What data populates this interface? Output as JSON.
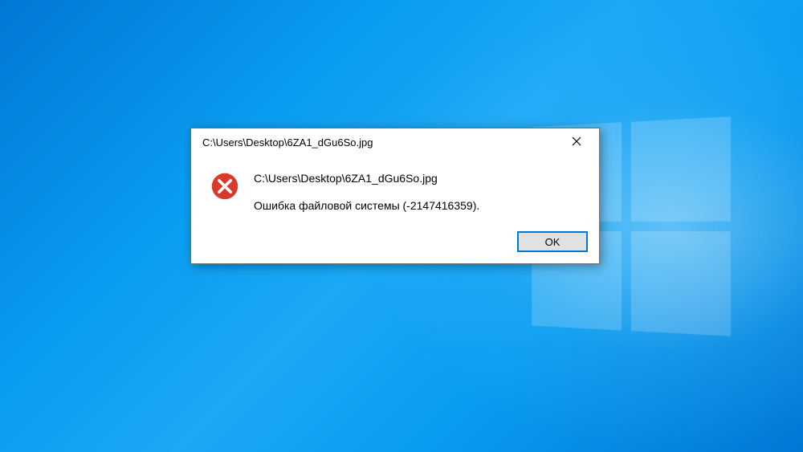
{
  "dialog": {
    "title": "C:\\Users\\Desktop\\6ZA1_dGu6So.jpg",
    "heading": "C:\\Users\\Desktop\\6ZA1_dGu6So.jpg",
    "message": "Ошибка файловой системы (-2147416359).",
    "ok_label": "OK"
  },
  "icons": {
    "error": "error-icon",
    "close": "close-icon"
  },
  "colors": {
    "error_icon_bg": "#d83b2a",
    "accent": "#0078d4",
    "dialog_bg": "#ffffff",
    "button_bg": "#e1e1e1"
  }
}
